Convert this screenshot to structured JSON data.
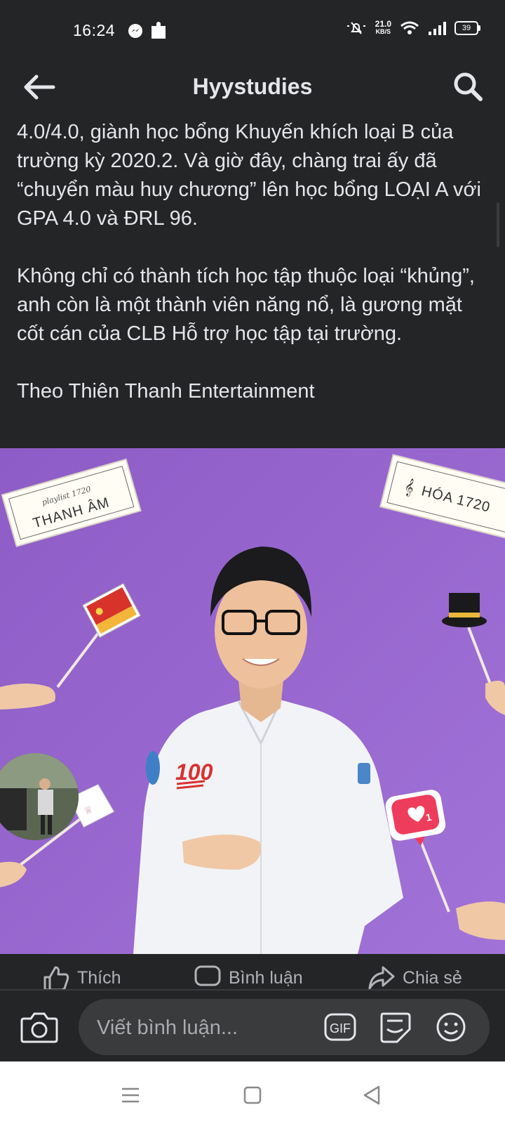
{
  "status_bar": {
    "time": "16:24",
    "net_speed_value": "21.0",
    "net_speed_unit": "KB/S",
    "battery": "39"
  },
  "header": {
    "title": "Hyystudies"
  },
  "post": {
    "paragraphs": [
      "4.0/4.0, giành học bổng Khuyến khích loại B của trường kỳ 2020.2. Và giờ đây, chàng trai ấy đã “chuyển màu huy chương” lên học bổng LOẠI A với GPA 4.0 và ĐRL 96.",
      "Không chỉ có thành tích học tập thuộc loại “khủng”, anh còn là một thành viên năng nổ, là gương mặt cốt cán của CLB Hỗ trợ học tập tại trường.",
      "Theo Thiên Thanh Entertainment"
    ]
  },
  "photo": {
    "sign_left_small": "playlist 1720",
    "sign_left": "THANH ÂM",
    "sign_right": "HÓA 1720",
    "badge": "100",
    "heart_count": "1"
  },
  "actions": {
    "like": "Thích",
    "comment": "Bình luận",
    "share": "Chia sẻ"
  },
  "comment_bar": {
    "placeholder": "Viết bình luận...",
    "gif_label": "GIF"
  },
  "colors": {
    "background": "#242526",
    "text": "#e4e6eb",
    "muted": "#b0b3b8",
    "photo_background": "#9160c8",
    "nav_bar": "#ffffff"
  }
}
